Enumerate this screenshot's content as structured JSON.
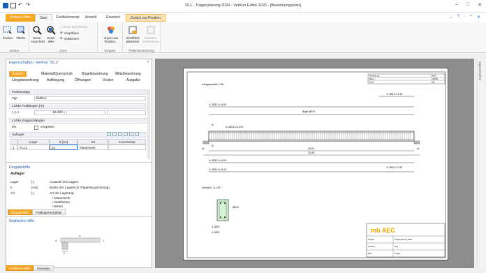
{
  "window": {
    "title": "DL1 - Trägerplanung 2024 - VerKon Editor 2025 - [Bewehrungsplan]",
    "controls": [
      "–",
      "□",
      "✕"
    ]
  },
  "tabs": {
    "context": "Verkon-Editor",
    "start": "Start",
    "graf": "Grafikelemente",
    "ansicht": "Ansicht",
    "erweitert": "Erweitert",
    "zuruck": "Zurück zur Position"
  },
  "ribbon_right": [
    "⌄",
    "?",
    "·",
    "⌃",
    "✕"
  ],
  "ribbon": {
    "modus": {
      "label": "Modus",
      "fenster": "Fenster",
      "flache": "Fläche"
    },
    "zoom": {
      "label": "Zoom",
      "ausschnitt": "Zoom Ausschnitt",
      "alles": "Zoom alles",
      "mehr": "Zoom Mehrfenster",
      "vergr": "Vergrößern",
      "verkl": "Verkleinern"
    },
    "eingabe": {
      "label": "Eingabe",
      "import": "Import aus Position..."
    },
    "platte": {
      "label": "Plattenbearbeitung",
      "schrift": "Schriftfeld platzieren",
      "standard": "Standard-Bearbeitung"
    }
  },
  "props": {
    "title": "Eigenschaften: VerKon \"DL1\"",
    "close": "✕",
    "tabs_row1": [
      "System",
      "Material/Querschnitt",
      "Bügelbewehrung",
      "Mittelbewehrung"
    ],
    "tabs_row2": [
      "Längsbewehrung",
      "Aufbiegung",
      "Öffnungen",
      "Vouten",
      "Ausgabe"
    ],
    "positionstyp": {
      "head": "Positionstyp",
      "typ_label": "Typ",
      "typ_value": "Balken"
    },
    "feld": {
      "head": "Lichte Feldlängen [m]",
      "l_label": "l_n,1",
      "l_value": "15.000"
    },
    "licht": {
      "head": "Lichte Kragarmlängen",
      "lk_label": "l/N",
      "lk_value": "vorgeben"
    },
    "auflager": {
      "head": "Auflager",
      "cols": [
        "Lager",
        "b [cm]",
        "Art",
        "Kommentar"
      ],
      "row": {
        "nr": "1",
        "lager": "ALL1",
        "b": "24",
        "art": "Mauerwerk",
        "kommentar": ""
      }
    },
    "collapse": "⌃"
  },
  "eingabehilfe": {
    "title": "Eingabehilfe",
    "sub": "Auflager",
    "rows": [
      {
        "k": "Lager",
        "u": "[-]",
        "d": "Auswahl des Lagers"
      },
      {
        "k": "b",
        "u": "[cm]",
        "d": "Breite des Lagers (in Trägerlängsrichtung)"
      },
      {
        "k": "Art",
        "u": "[-]",
        "d": "Art der Lagerung:"
      }
    ],
    "bullets": [
      "• Mauerwerk",
      "• Stahlbeton",
      "• Beton"
    ]
  },
  "help_tabs": [
    "Eingabehilfe",
    "Feldeigenschaften"
  ],
  "grafhilfe": {
    "title": "Grafische Hilfe",
    "label_b": "b",
    "labels": [
      "A",
      "B",
      "C"
    ]
  },
  "bottom_tabs": [
    "Grafische Hilfe",
    "Hinweise"
  ],
  "scroll_label": "Eigenschaften",
  "drawing": {
    "section_title": "Längsschnitt 1:50",
    "bar1": "① 2Ø12 l=14.00",
    "bar2": "② 2Ø12 l=14.00",
    "bar3": "③ 2Ø12 l=14.00",
    "bar4": "④ 2Ø12 l=14.00",
    "buegel": "Bügel Ø8/15",
    "dim_main": "15.00",
    "dim_total": "15.48",
    "dim_left": "24",
    "dim_right": "24",
    "label_right1": "② 2Ø12 l=1.90",
    "label_right2": "③ 2Ø12 l=1.90",
    "cross_title": "Schnitt A - A 1:20",
    "cross_label1": "① 2Ø12",
    "cross_label2": "② 2Ø12",
    "cross_label3": "Ø8/15",
    "legend_rows": [
      "Bewehrung",
      "Beton",
      "Stahl"
    ],
    "legend_vals": [
      "B500",
      "C25/30",
      "BSt"
    ],
    "brand": "mb AEC",
    "tb_rows": [
      "Projekt",
      "Trägerplanung 2024",
      "Position",
      "DL1",
      "Plan",
      "Träger"
    ]
  }
}
